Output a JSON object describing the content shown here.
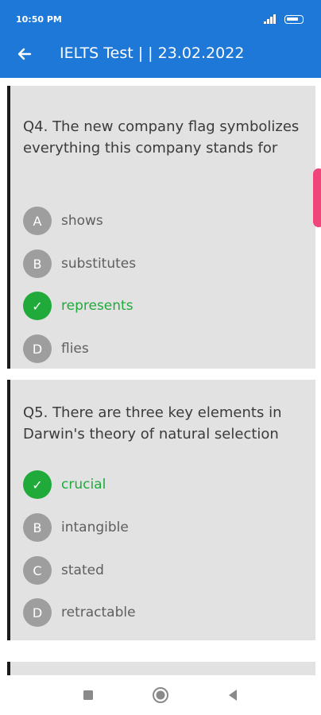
{
  "status_bar": {
    "time": "10:50 PM"
  },
  "app_bar": {
    "title": "IELTS Test | | 23.02.2022"
  },
  "questions": [
    {
      "text": "Q4. The new company flag symbolizes everything this company stands for",
      "options": [
        {
          "letter": "A",
          "label": "shows",
          "correct": false
        },
        {
          "letter": "B",
          "label": "substitutes",
          "correct": false
        },
        {
          "letter": "✓",
          "label": "represents",
          "correct": true
        },
        {
          "letter": "D",
          "label": "flies",
          "correct": false
        }
      ]
    },
    {
      "text": "Q5. There are three key elements in Darwin's theory of natural selection",
      "options": [
        {
          "letter": "✓",
          "label": "crucial",
          "correct": true
        },
        {
          "letter": "B",
          "label": "intangible",
          "correct": false
        },
        {
          "letter": "C",
          "label": "stated",
          "correct": false
        },
        {
          "letter": "D",
          "label": "retractable",
          "correct": false
        }
      ]
    }
  ],
  "colors": {
    "app_bar": "#1e78d8",
    "correct": "#1faa3a",
    "option_circle": "#9e9e9e",
    "card": "#e2e2e2",
    "scroll_thumb": "#f0457a"
  }
}
